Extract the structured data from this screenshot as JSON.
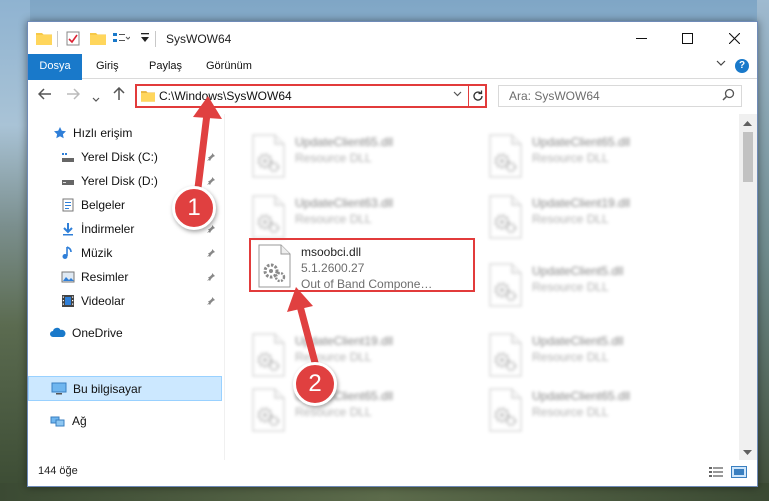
{
  "window": {
    "title": "SysWOW64"
  },
  "ribbon": {
    "tabs": [
      {
        "label": "Dosya"
      },
      {
        "label": "Giriş"
      },
      {
        "label": "Paylaş"
      },
      {
        "label": "Görünüm"
      }
    ],
    "help_label": "?"
  },
  "address_bar": {
    "path": "C:\\Windows\\SysWOW64"
  },
  "search": {
    "placeholder": "Ara: SysWOW64"
  },
  "nav_pane": {
    "quick_access": "Hızlı erişim",
    "items": [
      {
        "label": "Yerel Disk (C:)"
      },
      {
        "label": "Yerel Disk (D:)"
      },
      {
        "label": "Belgeler"
      },
      {
        "label": "İndirmeler"
      },
      {
        "label": "Müzik"
      },
      {
        "label": "Resimler"
      },
      {
        "label": "Videolar"
      }
    ],
    "onedrive": "OneDrive",
    "this_pc": "Bu bilgisayar",
    "network": "Ağ"
  },
  "files": [
    {
      "name": "UpdateClient65.dll",
      "desc": "Resource DLL",
      "blurred": true
    },
    {
      "name": "UpdateClient65.dll",
      "desc": "Resource DLL",
      "blurred": true
    },
    {
      "name": "UpdateClient63.dll",
      "desc": "Resource DLL",
      "blurred": true
    },
    {
      "name": "UpdateClient19.dll",
      "desc": "Resource DLL",
      "blurred": true
    },
    {
      "name": "msoobci.dll",
      "version": "5.1.2600.27",
      "desc": "Out of Band Compone…",
      "blurred": false
    },
    {
      "name": "UpdateClient5.dll",
      "desc": "Resource DLL",
      "blurred": true
    },
    {
      "name": "UpdateClient19.dll",
      "desc": "Resource DLL",
      "blurred": true
    },
    {
      "name": "UpdateClient5.dll",
      "desc": "Resource DLL",
      "blurred": true
    },
    {
      "name": "UpdateClient65.dll",
      "desc": "Resource DLL",
      "blurred": true
    },
    {
      "name": "UpdateClient65.dll",
      "desc": "Resource DLL",
      "blurred": true
    }
  ],
  "status": {
    "item_count": "144 öğe"
  },
  "callouts": {
    "one": "1",
    "two": "2"
  },
  "colors": {
    "accent": "#1979ca",
    "highlight": "#e23b3b",
    "selection": "#cce8ff"
  }
}
